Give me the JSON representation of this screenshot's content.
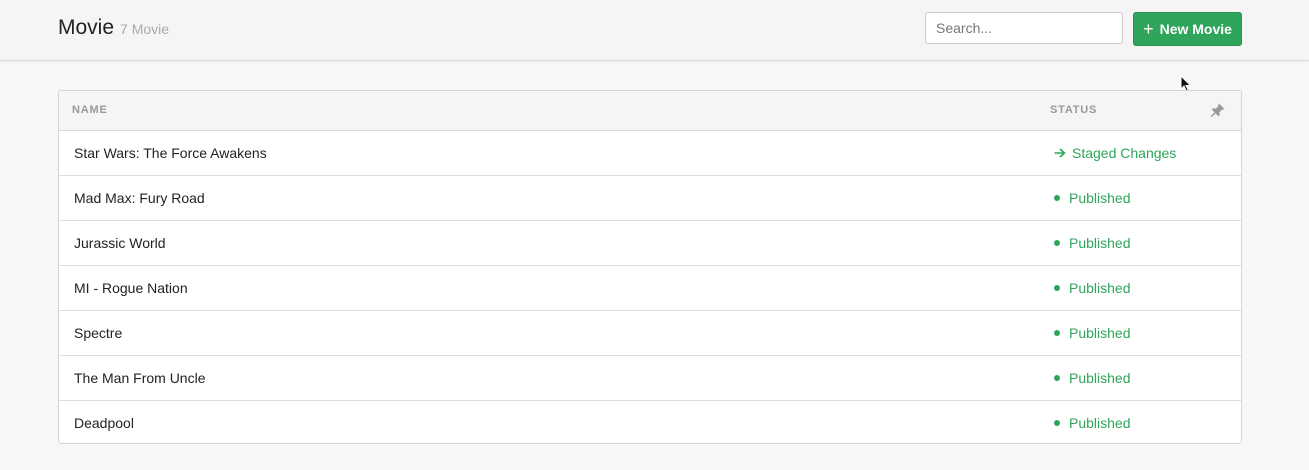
{
  "header": {
    "title": "Movie",
    "count": "7 Movie",
    "search_placeholder": "Search...",
    "new_button_label": "New Movie",
    "new_button_icon": "plus-icon"
  },
  "table": {
    "columns": {
      "name": "Name",
      "status": "Status"
    },
    "pin_icon": "pin-icon",
    "rows": [
      {
        "name": "Star Wars: The Force Awakens",
        "status": "Staged Changes",
        "status_icon": "arrow-right-icon"
      },
      {
        "name": "Mad Max: Fury Road",
        "status": "Published",
        "status_icon": "dot-icon"
      },
      {
        "name": "Jurassic World",
        "status": "Published",
        "status_icon": "dot-icon"
      },
      {
        "name": "MI - Rogue Nation",
        "status": "Published",
        "status_icon": "dot-icon"
      },
      {
        "name": "Spectre",
        "status": "Published",
        "status_icon": "dot-icon"
      },
      {
        "name": "The Man From Uncle",
        "status": "Published",
        "status_icon": "dot-icon"
      },
      {
        "name": "Deadpool",
        "status": "Published",
        "status_icon": "dot-icon"
      }
    ]
  },
  "colors": {
    "accent": "#2ea55a",
    "header_bg": "#f5f5f5",
    "page_bg": "#f7f7f7"
  }
}
